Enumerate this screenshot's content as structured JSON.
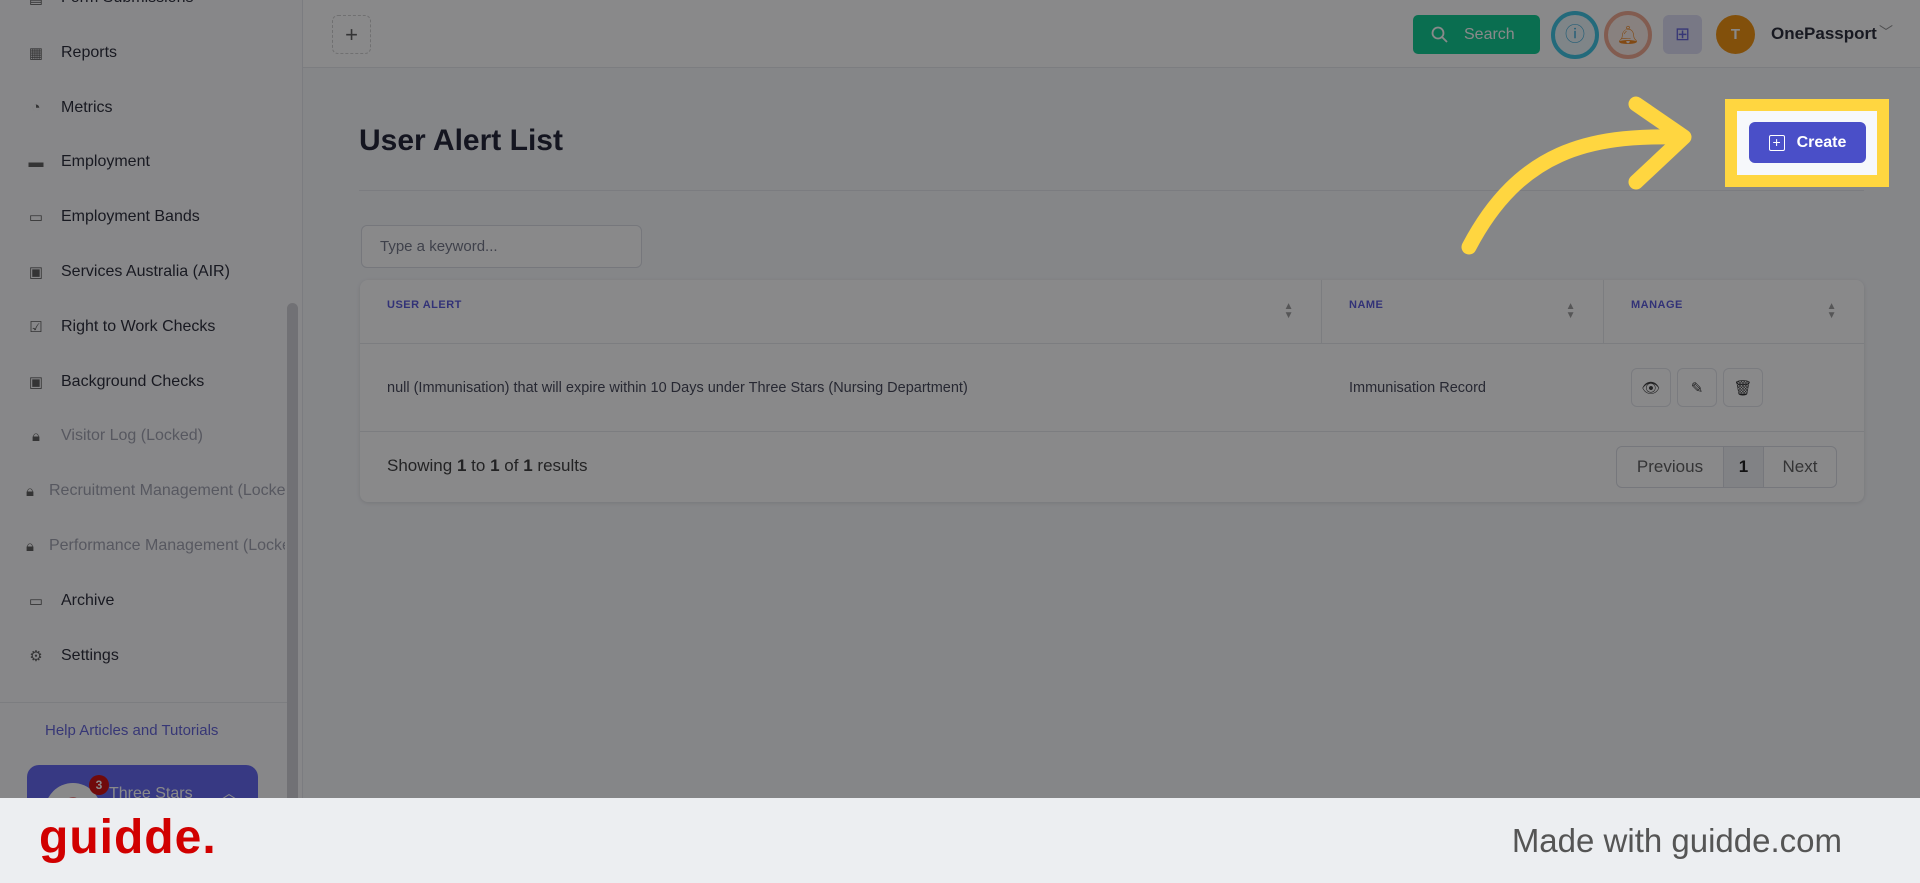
{
  "sidebar": {
    "items": [
      {
        "label": "Form Submissions",
        "icon": "form-icon",
        "locked": false
      },
      {
        "label": "Reports",
        "icon": "report-icon",
        "locked": false
      },
      {
        "label": "Metrics",
        "icon": "pie-chart-icon",
        "locked": false
      },
      {
        "label": "Employment",
        "icon": "briefcase-icon",
        "locked": false
      },
      {
        "label": "Employment Bands",
        "icon": "briefcase-outline-icon",
        "locked": false
      },
      {
        "label": "Services Australia (AIR)",
        "icon": "id-card-icon",
        "locked": false
      },
      {
        "label": "Right to Work Checks",
        "icon": "clipboard-check-icon",
        "locked": false
      },
      {
        "label": "Background Checks",
        "icon": "document-icon",
        "locked": false
      },
      {
        "label": "Visitor Log (Locked)",
        "icon": "lock-icon",
        "locked": true
      },
      {
        "label": "Recruitment Management (Locked)",
        "icon": "lock-icon",
        "locked": true
      },
      {
        "label": "Performance Management (Locked)",
        "icon": "lock-icon",
        "locked": true
      },
      {
        "label": "Archive",
        "icon": "archive-icon",
        "locked": false
      },
      {
        "label": "Settings",
        "icon": "gear-icon",
        "locked": false
      }
    ],
    "help_link": "Help Articles and Tutorials",
    "org": {
      "name": "Three Stars",
      "badge": "3",
      "logo_letter": "a"
    }
  },
  "header": {
    "search_label": "Search",
    "user_initial": "T",
    "user_name": "OnePassport"
  },
  "page": {
    "title": "User Alert List",
    "create_label": "Create",
    "search_placeholder": "Type a keyword..."
  },
  "table": {
    "columns": [
      "USER ALERT",
      "NAME",
      "MANAGE"
    ],
    "rows": [
      {
        "user_alert": "null (Immunisation) that will expire within 10 Days under Three Stars (Nursing Department)",
        "name": "Immunisation Record"
      }
    ],
    "showing": {
      "prefix": "Showing",
      "from": "1",
      "to_word": "to",
      "to": "1",
      "of_word": "of",
      "total": "1",
      "suffix": "results"
    },
    "pagination": {
      "previous": "Previous",
      "current": "1",
      "next": "Next"
    }
  },
  "footer": {
    "logo": "guidde.",
    "made_with": "Made with guidde.com"
  },
  "colors": {
    "highlight": "#ffd640",
    "primary": "#4a4fc8",
    "search": "#00c88a",
    "brand": "#d10000"
  }
}
